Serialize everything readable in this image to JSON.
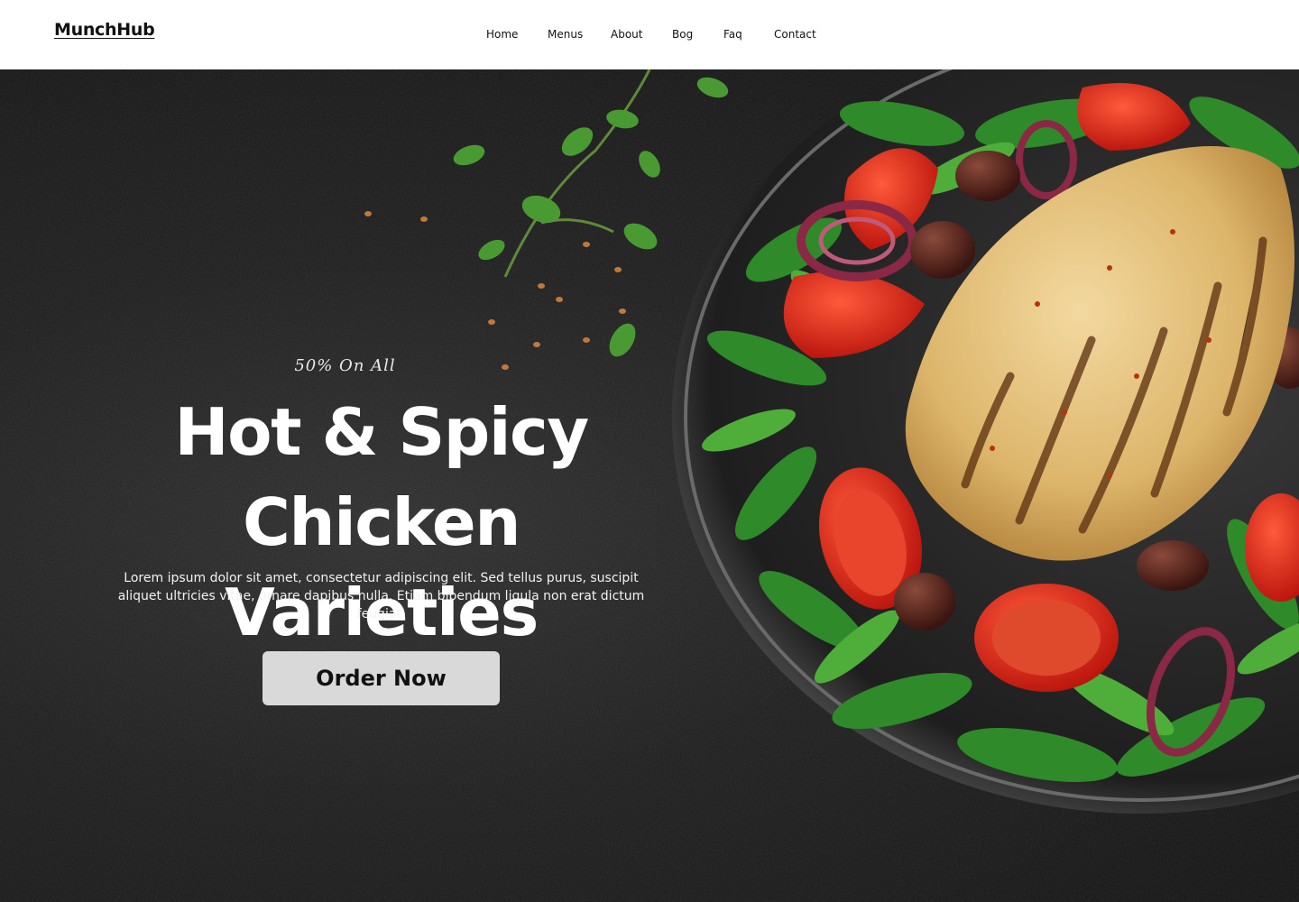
{
  "brand": {
    "name": "MunchHub"
  },
  "nav": {
    "items": [
      {
        "label": "Home"
      },
      {
        "label": "Menus"
      },
      {
        "label": "About"
      },
      {
        "label": "Bog"
      },
      {
        "label": "Faq"
      },
      {
        "label": "Contact"
      }
    ]
  },
  "hero": {
    "promo": "50% On All",
    "headline_line1": "Hot & Spicy Chicken",
    "headline_line2": "Varieties",
    "description": "Lorem ipsum dolor sit amet, consectetur adipiscing elit. Sed tellus purus, suscipit aliquet ultricies vitae, ornare dapibus nulla. Etiam bibendum ligula non erat dictum feugiat.",
    "cta_label": "Order Now",
    "image_icon": "grilled-chicken-salad-plate"
  },
  "colors": {
    "background": "#111111",
    "header": "#ffffff",
    "cta": "#d9d9d9",
    "text_light": "#ffffff"
  }
}
